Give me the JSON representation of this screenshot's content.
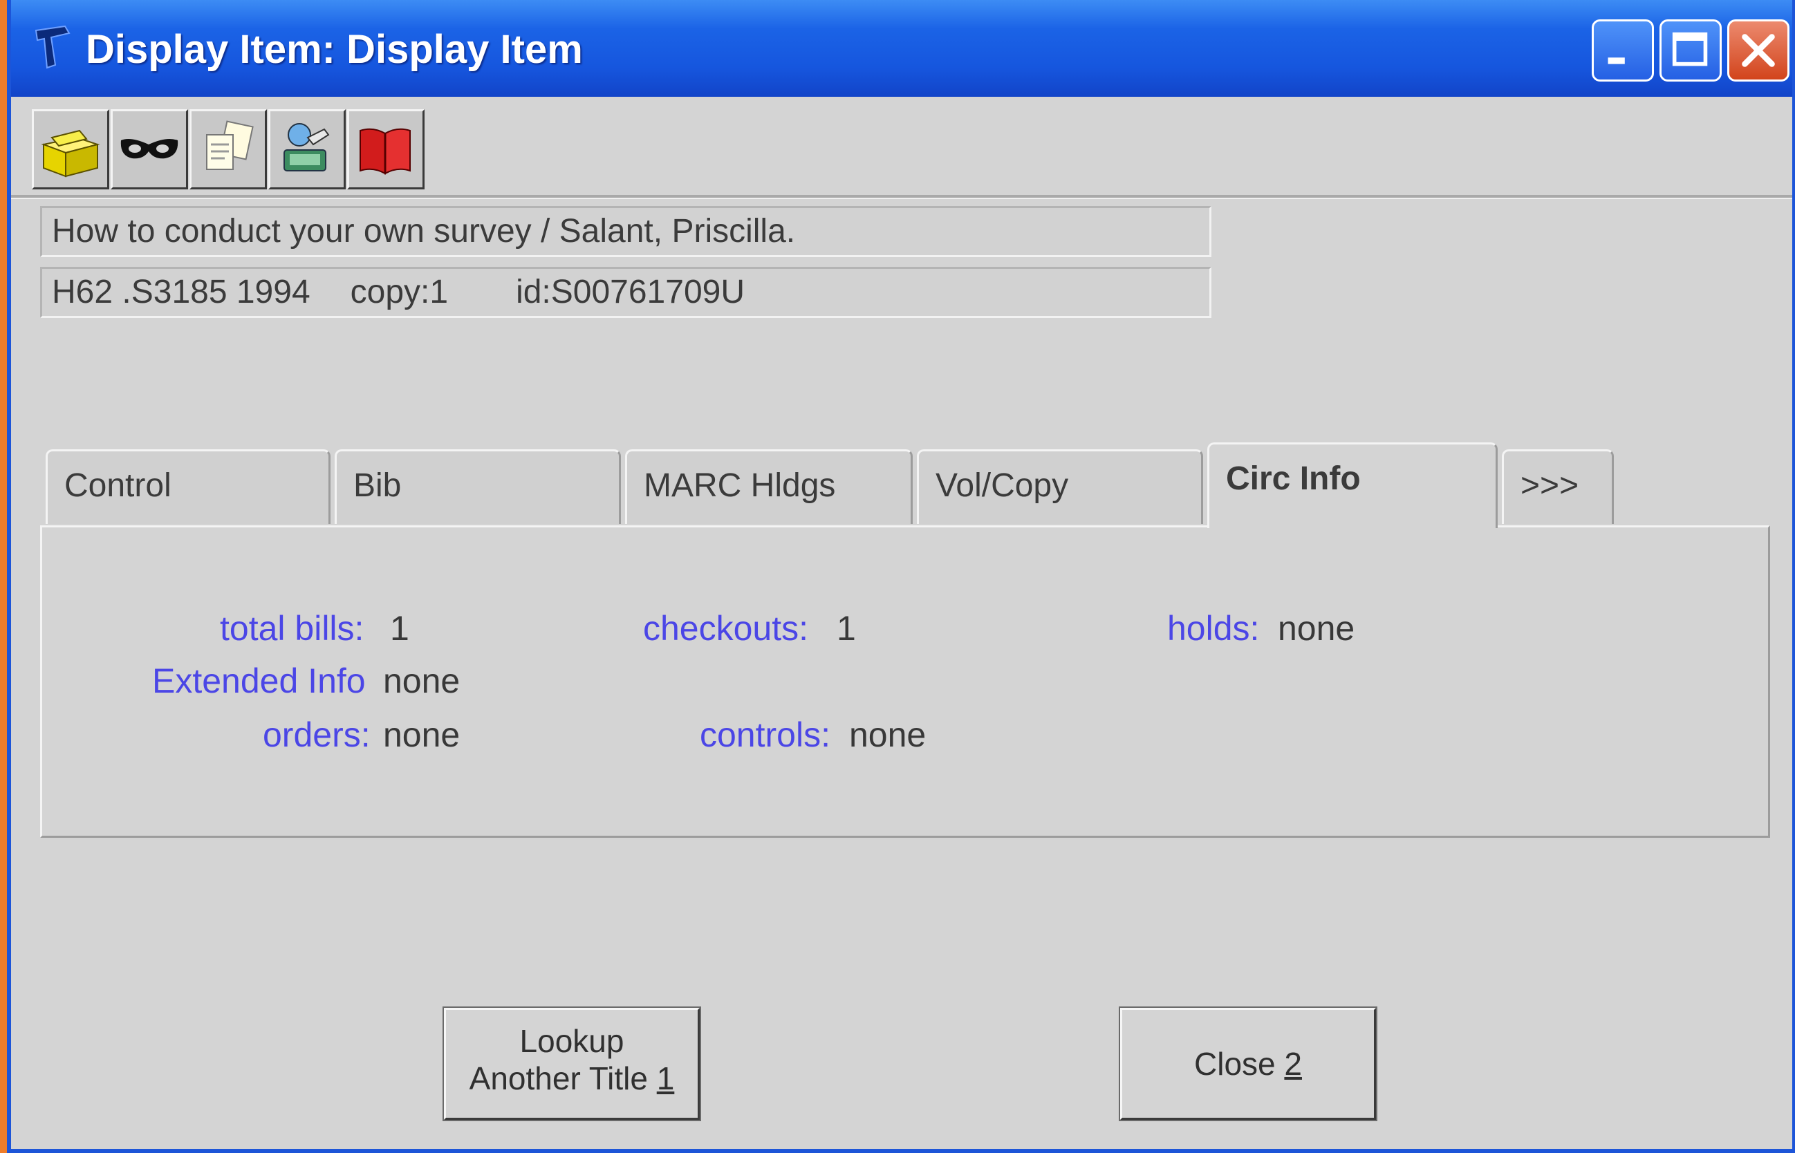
{
  "window": {
    "title": "Display Item: Display Item",
    "controls": {
      "minimize_icon": "minimize-icon",
      "maximize_icon": "maximize-icon",
      "close_icon": "close-icon"
    }
  },
  "toolbar": {
    "tools": [
      {
        "icon": "yellow-box-icon"
      },
      {
        "icon": "mask-icon"
      },
      {
        "icon": "documents-icon"
      },
      {
        "icon": "computer-hand-icon"
      },
      {
        "icon": "red-book-icon"
      }
    ]
  },
  "item": {
    "title_line": "How to conduct your own survey / Salant, Priscilla.",
    "call_number": "H62 .S3185 1994",
    "copy": "copy:1",
    "id": "id:S00761709U"
  },
  "tabs": [
    {
      "label": "Control",
      "active": false
    },
    {
      "label": "Bib",
      "active": false
    },
    {
      "label": "MARC Hldgs",
      "active": false
    },
    {
      "label": "Vol/Copy",
      "active": false
    },
    {
      "label": "Circ Info",
      "active": true
    },
    {
      "label": ">>>",
      "active": false
    }
  ],
  "circ_info": {
    "total_bills_label": "total bills:",
    "total_bills_value": "1",
    "checkouts_label": "checkouts:",
    "checkouts_value": "1",
    "holds_label": "holds:",
    "holds_value": "none",
    "extended_info_label": "Extended Info",
    "extended_info_value": "none",
    "orders_label": "orders:",
    "orders_value": "none",
    "controls_label": "controls:",
    "controls_value": "none"
  },
  "buttons": {
    "lookup_line1": "Lookup",
    "lookup_line2": "Another Title",
    "lookup_shortcut": "1",
    "close_label": "Close",
    "close_shortcut": "2"
  },
  "colors": {
    "label_blue": "#4b46e6",
    "titlebar_blue": "#1d5ade",
    "window_gray": "#d4d4d4"
  }
}
